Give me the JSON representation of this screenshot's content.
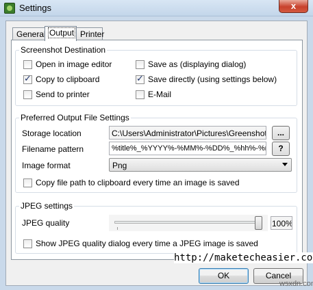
{
  "window": {
    "title": "Settings",
    "close_glyph": "x"
  },
  "tabs": [
    {
      "label": "General",
      "active": false
    },
    {
      "label": "Output",
      "active": true
    },
    {
      "label": "Printer",
      "active": false
    }
  ],
  "destination": {
    "title": "Screenshot Destination",
    "options": [
      {
        "label": "Open in image editor",
        "checked": false
      },
      {
        "label": "Copy to clipboard",
        "checked": true
      },
      {
        "label": "Send to printer",
        "checked": false
      },
      {
        "label": "Save as (displaying dialog)",
        "checked": false
      },
      {
        "label": "Save directly (using settings below)",
        "checked": true
      },
      {
        "label": "E-Mail",
        "checked": false
      }
    ]
  },
  "output": {
    "title": "Preferred Output File Settings",
    "storage_label": "Storage location",
    "storage_value": "C:\\Users\\Administrator\\Pictures\\Greenshot",
    "browse_label": "...",
    "pattern_label": "Filename pattern",
    "pattern_value": "%title%_%YYYY%-%MM%-%DD%_%hh%-%mm%-",
    "pattern_help_label": "?",
    "format_label": "Image format",
    "format_value": "Png",
    "copy_path_label": "Copy file path to clipboard every time an image is saved",
    "copy_path_checked": false
  },
  "jpeg": {
    "title": "JPEG settings",
    "quality_label": "JPEG quality",
    "quality_value": "100%",
    "quality_fraction": 1.0,
    "dialog_label": "Show JPEG quality dialog every time a JPEG image is saved",
    "dialog_checked": false
  },
  "buttons": {
    "ok": "OK",
    "cancel": "Cancel"
  },
  "watermark": {
    "url": "http://maketecheasier.com",
    "site": "wsxdn.com"
  }
}
